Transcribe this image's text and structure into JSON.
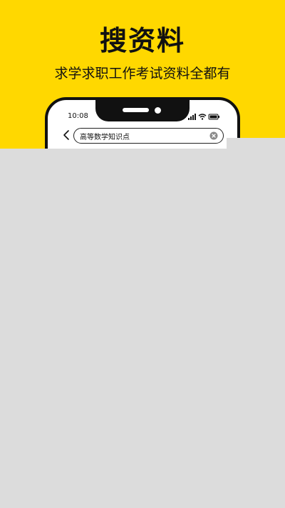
{
  "hero": {
    "title": "搜资料",
    "subtitle": "求学求职工作考试资料全都有",
    "background_color": "#ffd800"
  },
  "phone": {
    "status_bar": {
      "time": "10:08",
      "icons": [
        "signal-icon",
        "wifi-icon",
        "battery-icon"
      ]
    },
    "search": {
      "value": "高等数学知识点",
      "back_icon": "chevron-left-icon",
      "clear_icon": "clear-circle-icon"
    }
  }
}
